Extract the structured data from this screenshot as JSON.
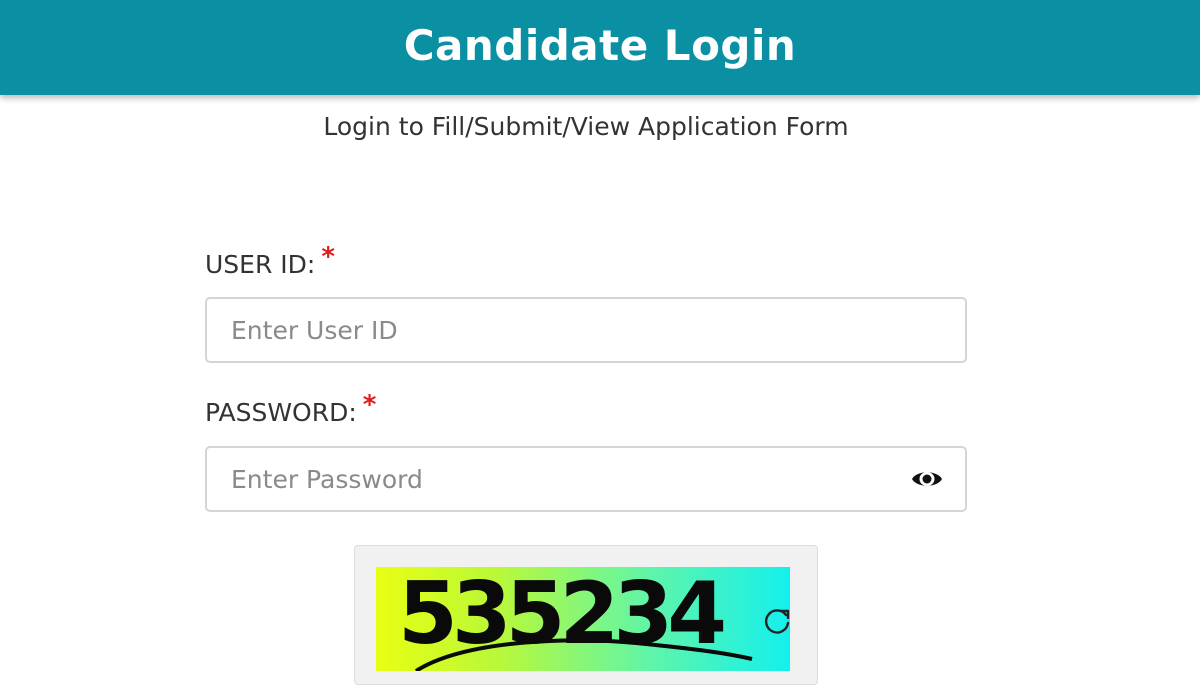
{
  "header": {
    "title": "Candidate Login"
  },
  "subtitle": "Login to Fill/Submit/View Application Form",
  "form": {
    "user_id": {
      "label": "USER ID:",
      "required_mark": "*",
      "placeholder": "Enter User ID",
      "value": ""
    },
    "password": {
      "label": "PASSWORD:",
      "required_mark": "*",
      "placeholder": "Enter Password",
      "value": "",
      "toggle_icon": "eye-icon"
    },
    "captcha": {
      "code": "535234",
      "refresh_icon": "refresh-icon"
    }
  },
  "colors": {
    "header_bg": "#0a8fa3",
    "header_text": "#ffffff",
    "required": "#e01b1b",
    "label_text": "#333333"
  }
}
